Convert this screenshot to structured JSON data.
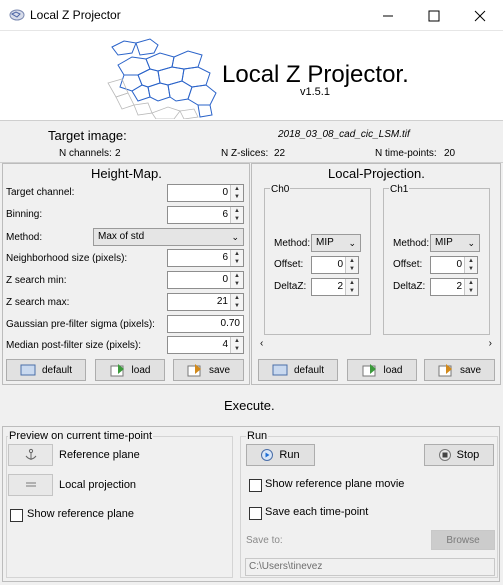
{
  "window": {
    "title": "Local Z Projector",
    "minimize_icon": "minimize-icon",
    "maximize_icon": "maximize-icon",
    "close_icon": "close-icon"
  },
  "header": {
    "app_name": "Local Z Projector.",
    "version": "v1.5.1",
    "logo": "cell-mesh-logo"
  },
  "target": {
    "label": "Target image:",
    "filename": "2018_03_08_cad_cic_LSM.tif",
    "channels_label": "N channels:",
    "channels": "2",
    "zslices_label": "N Z-slices:",
    "zslices": "22",
    "timepoints_label": "N time-points:",
    "timepoints": "20"
  },
  "heightmap": {
    "title": "Height-Map.",
    "target_channel_label": "Target channel:",
    "target_channel": "0",
    "binning_label": "Binning:",
    "binning": "6",
    "method_label": "Method:",
    "method": "Max of std",
    "neighborhood_label": "Neighborhood size (pixels):",
    "neighborhood": "6",
    "zmin_label": "Z search min:",
    "zmin": "0",
    "zmax_label": "Z search max:",
    "zmax": "21",
    "gauss_label": "Gaussian pre-filter sigma (pixels):",
    "gauss": "0.70",
    "median_label": "Median post-filter size (pixels):",
    "median": "4",
    "default_label": "default",
    "load_label": "load",
    "save_label": "save"
  },
  "localproj": {
    "title": "Local-Projection.",
    "channels": [
      {
        "name": "Ch0",
        "method_label": "Method:",
        "method": "MIP",
        "offset_label": "Offset:",
        "offset": "0",
        "deltaz_label": "DeltaZ:",
        "deltaz": "2"
      },
      {
        "name": "Ch1",
        "method_label": "Method:",
        "method": "MIP",
        "offset_label": "Offset:",
        "offset": "0",
        "deltaz_label": "DeltaZ:",
        "deltaz": "2"
      }
    ],
    "default_label": "default",
    "load_label": "load",
    "save_label": "save"
  },
  "execute": {
    "title": "Execute.",
    "preview_title": "Preview on current time-point",
    "reference_plane_label": "Reference plane",
    "local_projection_label": "Local projection",
    "show_reference_plane_label": "Show reference plane",
    "run_title": "Run",
    "run_label": "Run",
    "stop_label": "Stop",
    "show_movie_label": "Show reference plane movie",
    "save_each_label": "Save each time-point",
    "save_to_label": "Save to:",
    "browse_label": "Browse",
    "save_path": "C:\\Users\\tinevez"
  },
  "colors": {
    "accent": "#1f6fd6",
    "stop_red": "#444444",
    "load_green": "#3c9a3c",
    "save_orange": "#d28a1c"
  }
}
